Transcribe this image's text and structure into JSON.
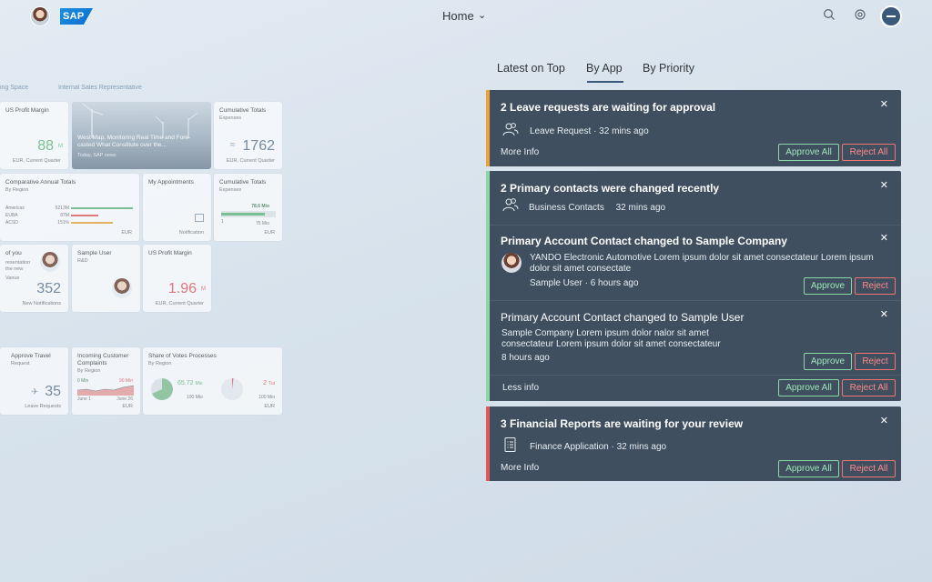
{
  "shell": {
    "title": "Home",
    "logo_text": "SAP"
  },
  "launchpad": {
    "groups": [
      "ing Space",
      "Internal Sales Representative"
    ],
    "tiles": {
      "profit1": {
        "title": "US Profit Margin",
        "value": "88",
        "unit": "M",
        "footer": "EUR, Current Quarter"
      },
      "news": {
        "text": "West Map, Monitoring Real Time and Fore-casted What Constitute over the...",
        "source": "Today, SAP news"
      },
      "cumulative1": {
        "title": "Cumulative Totals",
        "subtitle": "Expenses",
        "value": "1762",
        "footer": "EUR, Current Quarter"
      },
      "comparative": {
        "title": "Comparative Annual Totals",
        "subtitle": "By Region",
        "rows": [
          {
            "label": "Americas",
            "value": "5213M"
          },
          {
            "label": "EUBA",
            "value": "87M"
          },
          {
            "label": "ACSD",
            "value": "151%"
          }
        ],
        "footer": "EUR"
      },
      "appointments": {
        "title": "My Appointments",
        "footer": "Notification"
      },
      "cumulative2": {
        "title": "Cumulative Totals",
        "subtitle": "Expenses",
        "top": "78.6 Mio",
        "left": "1",
        "right": "75 Mio",
        "footer": "EUR"
      },
      "ofyou": {
        "title": "of you",
        "sub1": "resentation",
        "sub2": "the new",
        "sub3": "Vanue",
        "value": "352",
        "footer": "New Notifications"
      },
      "sample": {
        "title": "Sample User",
        "subtitle": "R&D"
      },
      "profit2": {
        "title": "US Profit Margin",
        "value": "1.96",
        "unit": "M",
        "footer": "EUR, Current Quarter"
      },
      "travel": {
        "title": "Approve Travel",
        "subtitle": "Request",
        "value": "35",
        "footer": "Leave Requests"
      },
      "complaints": {
        "title": "Incoming Customer Complaints",
        "subtitle": "By Region",
        "left_top": "0 Min",
        "right_top": "90 Min",
        "left_bottom": "June 1",
        "right_bottom": "June 26",
        "footer": "EUR"
      },
      "votes": {
        "title": "Share of Votes Processes",
        "subtitle": "By Region",
        "v1": "65.72",
        "v1_unit": "Mio",
        "v1_sub": "100 Mio",
        "v2": "2",
        "v2_unit": "Tut",
        "v2_sub": "100 Mio",
        "footer": "EUR"
      }
    }
  },
  "tabs": [
    "Latest on Top",
    "By App",
    "By Priority"
  ],
  "active_tab": "By App",
  "colors": {
    "card_bg": "#3f4f5f",
    "medium": "#e8a33d",
    "none": "#8cd7a6",
    "high": "#e05a5a",
    "approve": "#9ee6b8",
    "reject": "#ff8a8a"
  },
  "notifications": {
    "leave": {
      "title": "2 Leave requests are waiting for approval",
      "app": "Leave Request",
      "time": "32 mins ago",
      "more": "More Info",
      "approve_all": "Approve All",
      "reject_all": "Reject All",
      "icon": "people-icon"
    },
    "contacts": {
      "title": "2 Primary contacts were changed recently",
      "app": "Business Contacts",
      "time": "32 mins ago",
      "icon": "people-icon",
      "items": [
        {
          "title": "Primary Account Contact changed to Sample Company",
          "body": "YANDO Electronic Automotive Lorem ipsum dolor sit amet consectateur Lorem ipsum dolor sit amet consectate",
          "user": "Sample User",
          "time": "6 hours ago",
          "approve": "Approve",
          "reject": "Reject"
        },
        {
          "title": "Primary Account Contact changed to Sample User",
          "body": "Sample Company Lorem ipsum dolor nalor sit amet consectateur Lorem ipsum dolor sit amet consectateur",
          "time": "8 hours ago",
          "approve": "Approve",
          "reject": "Reject"
        }
      ],
      "less": "Less info",
      "approve_all": "Approve All",
      "reject_all": "Reject All"
    },
    "reports": {
      "title": "3 Financial Reports are waiting for your review",
      "app": "Finance Application",
      "time": "32 mins ago",
      "more": "More Info",
      "approve_all": "Approve All",
      "reject_all": "Reject All",
      "icon": "document-list-icon"
    }
  }
}
